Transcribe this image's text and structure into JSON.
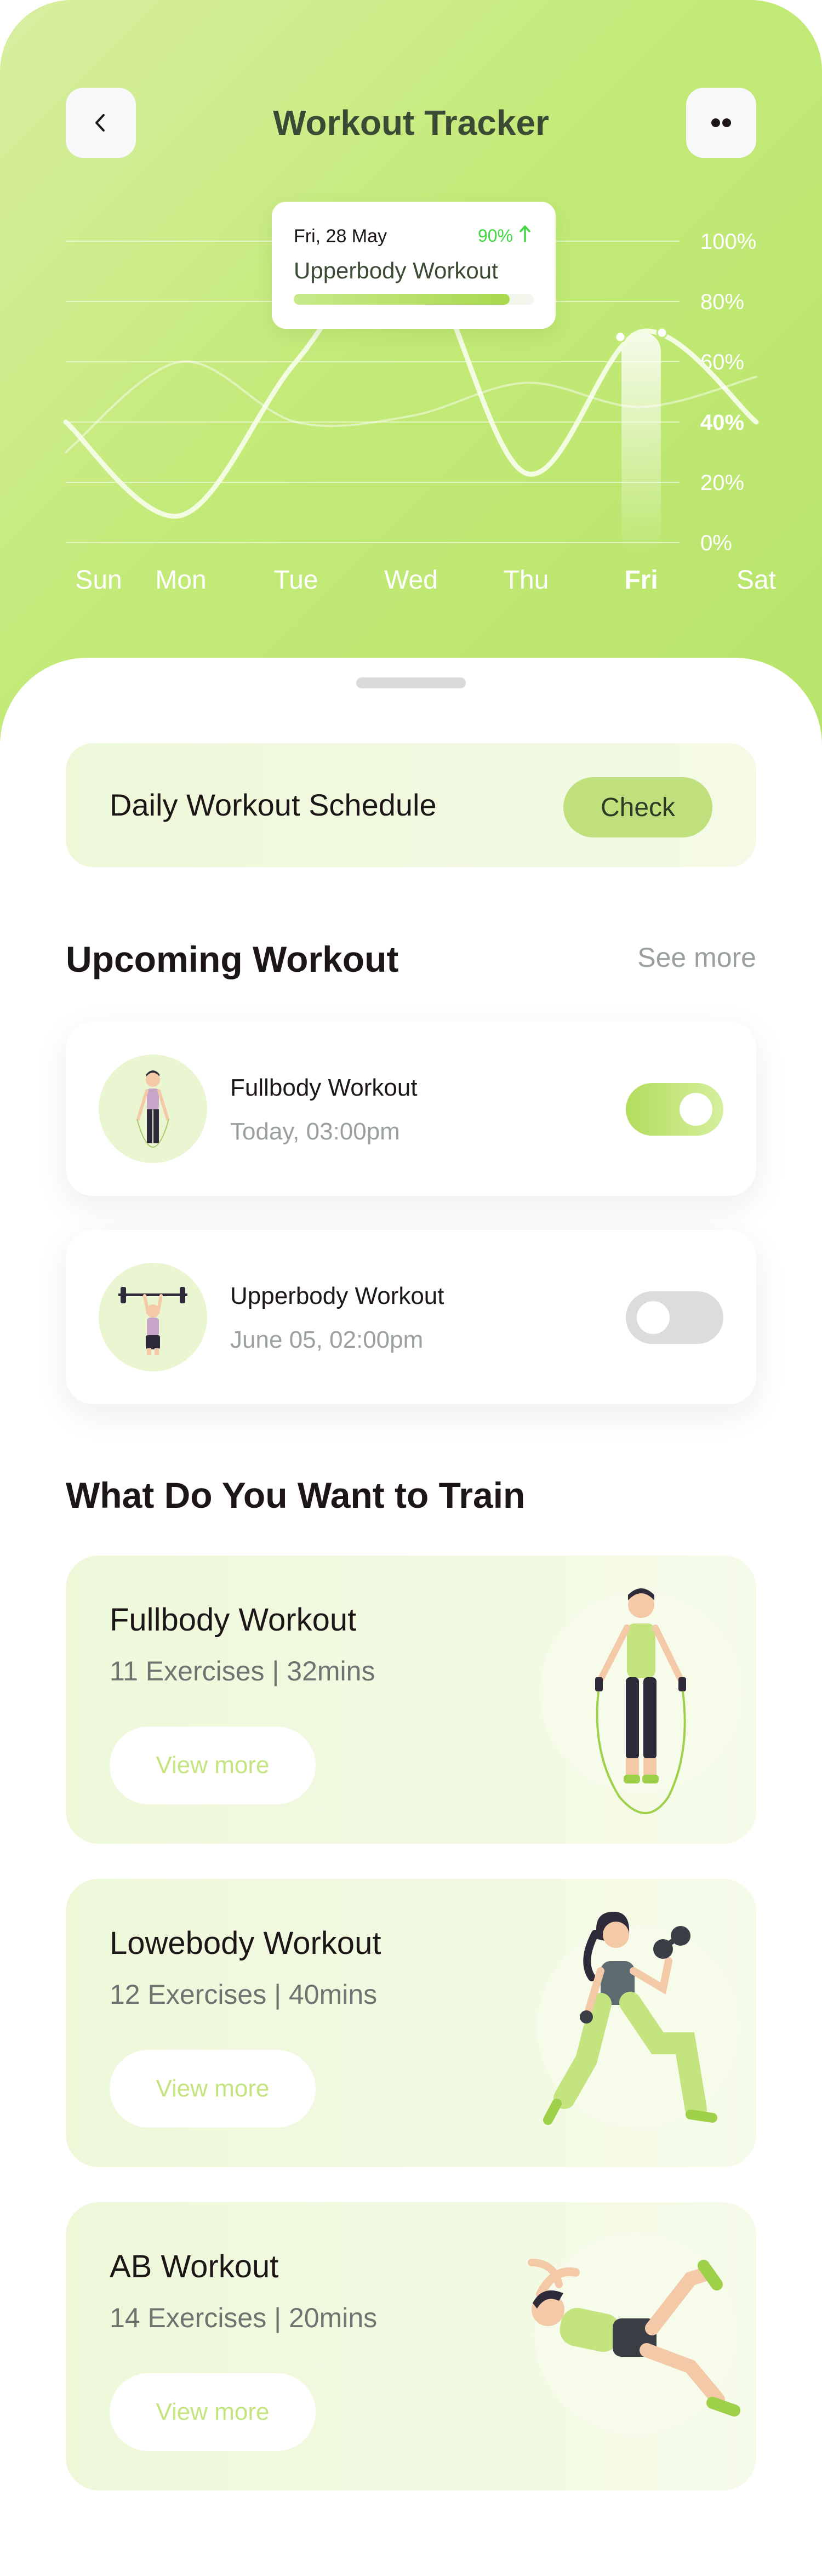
{
  "header": {
    "title": "Workout Tracker",
    "back_icon": "chevron-left-icon",
    "more_icon": "more-dots-icon"
  },
  "chart_data": {
    "type": "line",
    "categories": [
      "Sun",
      "Mon",
      "Tue",
      "Wed",
      "Thu",
      "Fri",
      "Sat"
    ],
    "highlighted_category": "Fri",
    "ytick_labels": [
      "0%",
      "20%",
      "40%",
      "60%",
      "80%",
      "100%"
    ],
    "highlighted_ytick": "40%",
    "ylim": [
      0,
      100
    ],
    "series": [
      {
        "values": [
          40,
          9,
          60,
          98,
          23,
          70,
          40
        ],
        "style": "solid",
        "color": "#f3fbe1"
      },
      {
        "values": [
          30,
          60,
          40,
          42,
          53,
          45,
          55
        ],
        "style": "faint",
        "color": "#ffffff"
      }
    ],
    "grid": true
  },
  "tooltip": {
    "date": "Fri, 28 May",
    "percent": "90%",
    "workout": "Upperbody Workout",
    "progress": 0.9
  },
  "schedule": {
    "label": "Daily Workout Schedule",
    "button": "Check"
  },
  "upcoming": {
    "title": "Upcoming Workout",
    "see_more": "See more",
    "items": [
      {
        "name": "Fullbody Workout",
        "time": "Today, 03:00pm",
        "enabled": true
      },
      {
        "name": "Upperbody Workout",
        "time": "June 05, 02:00pm",
        "enabled": false
      }
    ]
  },
  "train": {
    "title": "What Do You Want to Train",
    "cards": [
      {
        "title": "Fullbody Workout",
        "subtitle": "11 Exercises | 32mins",
        "button": "View more"
      },
      {
        "title": "Lowebody Workout",
        "subtitle": "12 Exercises | 40mins",
        "button": "View more"
      },
      {
        "title": "AB Workout",
        "subtitle": "14 Exercises | 20mins",
        "button": "View more"
      }
    ]
  },
  "colors": {
    "brand_green": "#c3ea78",
    "text_dark": "#1d1617",
    "text_gray": "#9aa0a0",
    "positive": "#42d742"
  }
}
